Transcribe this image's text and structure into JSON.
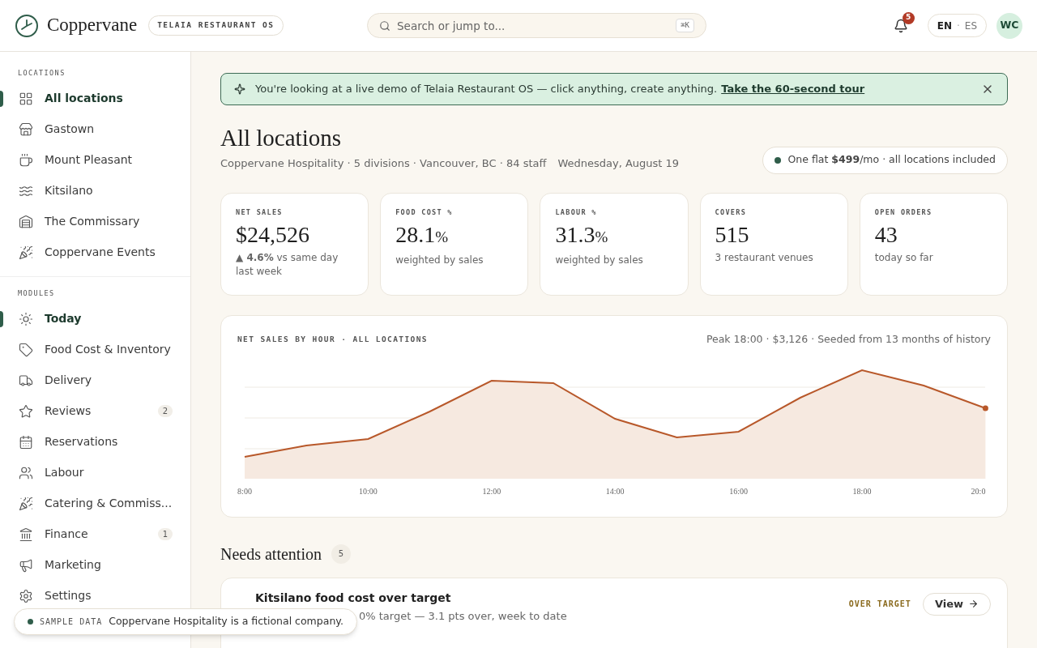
{
  "header": {
    "brand": "Coppervane",
    "product_badge": "TELAIA RESTAURANT OS",
    "search": {
      "placeholder": "Search or jump to...",
      "shortcut": "⌘K"
    },
    "notifications": {
      "count": "5"
    },
    "languages": [
      {
        "label": "EN",
        "selected": true
      },
      {
        "label": "ES",
        "selected": false
      }
    ],
    "language_separator": "·",
    "avatar": "WC"
  },
  "sidebar": [
    {
      "heading": "LOCATIONS",
      "items": [
        {
          "label": "All locations",
          "selected": true
        },
        {
          "label": "Gastown",
          "selected": false
        },
        {
          "label": "Mount Pleasant",
          "selected": false
        },
        {
          "label": "Kitsilano",
          "selected": false
        },
        {
          "label": "The Commissary",
          "selected": false
        },
        {
          "label": "Coppervane Events",
          "selected": false
        }
      ]
    },
    {
      "heading": "MODULES",
      "items": [
        {
          "label": "Today",
          "selected": true
        },
        {
          "label": "Food Cost & Inventory",
          "selected": false
        },
        {
          "label": "Delivery",
          "selected": false
        },
        {
          "label": "Reviews",
          "selected": false,
          "badge": "2"
        },
        {
          "label": "Reservations",
          "selected": false
        },
        {
          "label": "Labour",
          "selected": false
        },
        {
          "label": "Catering & Commiss...",
          "selected": false
        },
        {
          "label": "Finance",
          "selected": false,
          "badge": "1"
        },
        {
          "label": "Marketing",
          "selected": false
        },
        {
          "label": "Settings",
          "selected": false
        }
      ]
    }
  ],
  "banner": {
    "text": "You're looking at a live demo of Telaia Restaurant OS — click anything, create anything.",
    "link": "Take the 60-second tour"
  },
  "page": {
    "title": "All locations",
    "subtitle": "Coppervane Hospitality · 5 divisions · Vancouver, BC · 84 staff",
    "date": "Wednesday, August 19",
    "pricing": "One flat **$499**/mo · all locations included"
  },
  "kpis": [
    {
      "label": "NET SALES",
      "value": "$24,526",
      "note": "**▲ 4.6%** vs same day last week"
    },
    {
      "label": "FOOD COST %",
      "value": "28.1",
      "unit": "%",
      "note": "weighted by sales"
    },
    {
      "label": "LABOUR %",
      "value": "31.3",
      "unit": "%",
      "note": "weighted by sales"
    },
    {
      "label": "COVERS",
      "value": "515",
      "note": "3 restaurant venues"
    },
    {
      "label": "OPEN ORDERS",
      "value": "43",
      "note": "today so far"
    }
  ],
  "sales_chart": {
    "title": "NET SALES BY HOUR · ALL LOCATIONS",
    "summary": "Peak 18:00 · $3,126 · Seeded from 13 months of history",
    "x_labels": [
      "8:00",
      "10:00",
      "12:00",
      "14:00",
      "16:00",
      "18:00",
      "20:0"
    ]
  },
  "attention": {
    "title": "Needs attention",
    "count": "5",
    "items": [
      {
        "title": "Kitsilano food cost over target",
        "detail": "0% target — 3.1 pts over, week to date",
        "status": "OVER TARGET",
        "action": "View"
      }
    ]
  },
  "toast": {
    "tag": "SAMPLE DATA",
    "text": "Coppervane Hospitality is a fictional company."
  }
}
